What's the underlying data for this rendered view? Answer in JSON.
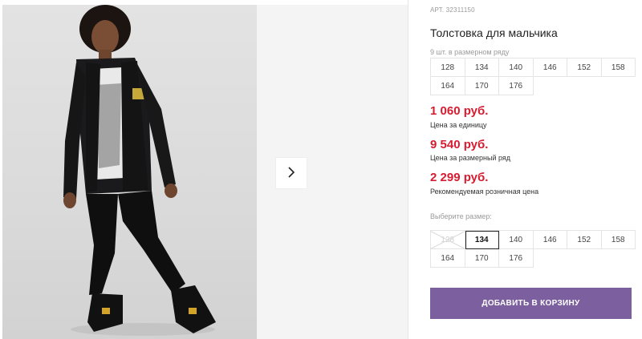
{
  "product": {
    "sku": "АРТ. 32311150",
    "title": "Толстовка для мальчика"
  },
  "pack": {
    "label": "9 шт. в размерном ряду",
    "sizes": [
      "128",
      "134",
      "140",
      "146",
      "152",
      "158",
      "164",
      "170",
      "176"
    ]
  },
  "prices": {
    "unit_price": "1 060 руб.",
    "unit_label": "Цена за единицу",
    "pack_price": "9 540 руб.",
    "pack_label": "Цена за размерный ряд",
    "retail_price": "2 299 руб.",
    "retail_label": "Рекомендуемая розничная цена"
  },
  "size_select": {
    "label": "Выберите размер:",
    "sizes": [
      "128",
      "134",
      "140",
      "146",
      "152",
      "158",
      "164",
      "170",
      "176"
    ],
    "selected": "134",
    "unavailable": [
      "128"
    ]
  },
  "cart_button": "ДОБАВИТЬ В КОРЗИНУ",
  "icons": {
    "next": "chevron-right-icon"
  },
  "colors": {
    "price": "#d61c30",
    "button": "#7b5f9e"
  }
}
